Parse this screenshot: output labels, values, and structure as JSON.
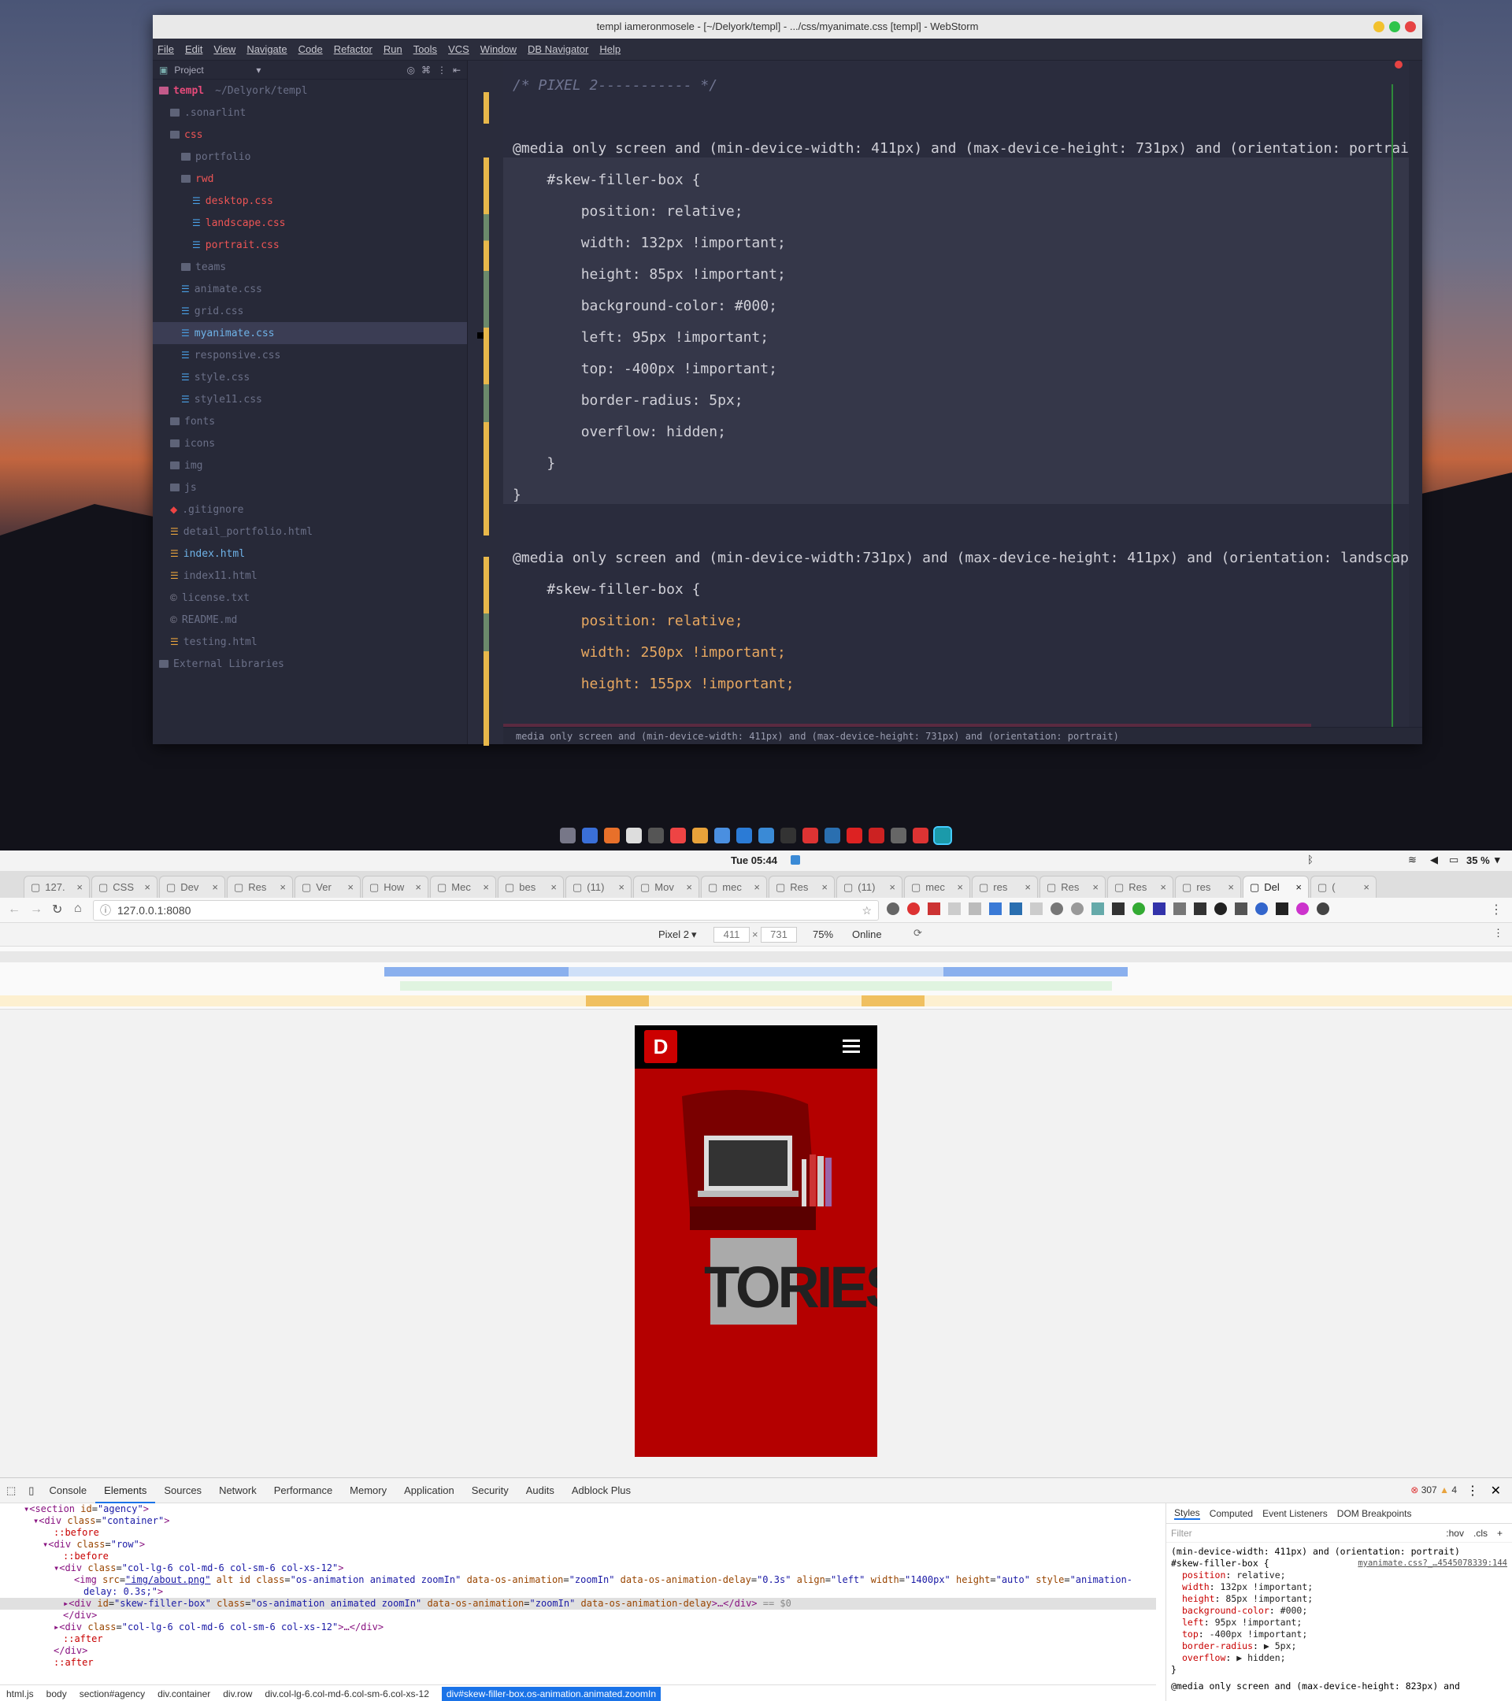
{
  "ide": {
    "title": "templ iameronmosele - [~/Delyork/templ] - .../css/myanimate.css [templ] - WebStorm",
    "menu": [
      "File",
      "Edit",
      "View",
      "Navigate",
      "Code",
      "Refactor",
      "Run",
      "Tools",
      "VCS",
      "Window",
      "DB Navigator",
      "Help"
    ],
    "project_label": "Project",
    "tree": [
      {
        "label": "templ",
        "extra": "~/Delyork/templ",
        "depth": 0,
        "type": "root"
      },
      {
        "label": ".sonarlint",
        "depth": 1,
        "type": "folder",
        "dim": true
      },
      {
        "label": "css",
        "depth": 1,
        "type": "folder",
        "color": "#e55"
      },
      {
        "label": "portfolio",
        "depth": 2,
        "type": "folder",
        "dim": true
      },
      {
        "label": "rwd",
        "depth": 2,
        "type": "folder",
        "color": "#e55"
      },
      {
        "label": "desktop.css",
        "depth": 3,
        "type": "css",
        "color": "#e55"
      },
      {
        "label": "landscape.css",
        "depth": 3,
        "type": "css",
        "color": "#e55"
      },
      {
        "label": "portrait.css",
        "depth": 3,
        "type": "css",
        "color": "#e55"
      },
      {
        "label": "teams",
        "depth": 2,
        "type": "folder",
        "dim": true
      },
      {
        "label": "animate.css",
        "depth": 2,
        "type": "css",
        "dim": true
      },
      {
        "label": "grid.css",
        "depth": 2,
        "type": "css",
        "dim": true
      },
      {
        "label": "myanimate.css",
        "depth": 2,
        "type": "css",
        "color": "#6fb3e8",
        "selected": true
      },
      {
        "label": "responsive.css",
        "depth": 2,
        "type": "css",
        "dim": true
      },
      {
        "label": "style.css",
        "depth": 2,
        "type": "css",
        "dim": true
      },
      {
        "label": "style11.css",
        "depth": 2,
        "type": "css",
        "dim": true
      },
      {
        "label": "fonts",
        "depth": 1,
        "type": "folder",
        "dim": true
      },
      {
        "label": "icons",
        "depth": 1,
        "type": "folder",
        "dim": true
      },
      {
        "label": "img",
        "depth": 1,
        "type": "folder",
        "dim": true
      },
      {
        "label": "js",
        "depth": 1,
        "type": "folder",
        "dim": true
      },
      {
        "label": ".gitignore",
        "depth": 1,
        "type": "git",
        "dim": true
      },
      {
        "label": "detail_portfolio.html",
        "depth": 1,
        "type": "html",
        "dim": true
      },
      {
        "label": "index.html",
        "depth": 1,
        "type": "html",
        "color": "#6fb3e8"
      },
      {
        "label": "index11.html",
        "depth": 1,
        "type": "html",
        "dim": true
      },
      {
        "label": "license.txt",
        "depth": 1,
        "type": "txt",
        "dim": true
      },
      {
        "label": "README.md",
        "depth": 1,
        "type": "txt",
        "dim": true
      },
      {
        "label": "testing.html",
        "depth": 1,
        "type": "html",
        "dim": true
      },
      {
        "label": "External Libraries",
        "depth": 0,
        "type": "lib",
        "dim": true
      }
    ],
    "code": [
      "/* PIXEL 2----------- */",
      "",
      "@media only screen and (min-device-width: 411px) and (max-device-height: 731px) and (orientation: portrait) {",
      "    #skew-filler-box {",
      "        position: relative;",
      "        width: 132px !important;",
      "        height: 85px !important;",
      "        background-color: #000;",
      "        left: 95px !important;",
      "        top: -400px !important;",
      "        border-radius: 5px;",
      "        overflow: hidden;",
      "    }",
      "}",
      "",
      "@media only screen and (min-device-width:731px) and (max-device-height: 411px) and (orientation: landscape) {",
      "    #skew-filler-box {",
      "        position: relative;",
      "        width: 250px !important;",
      "        height: 155px !important;"
    ],
    "breadcrumb": "media only screen and (min-device-width: 411px) and (max-device-height: 731px) and (orientation: portrait)"
  },
  "mac": {
    "clock": "Tue 05:44",
    "battery": "35 %"
  },
  "browser": {
    "tabs": [
      "127.",
      "CSS",
      "Dev",
      "Res",
      "Ver",
      "How",
      "Mec",
      "bes",
      "(11)",
      "Mov",
      "mec",
      "Res",
      "(11)",
      "mec",
      "res",
      "Res",
      "Res",
      "res",
      "Del",
      "("
    ],
    "url": "127.0.0.1:8080",
    "device": "Pixel 2",
    "width": "411",
    "height": "731",
    "zoom": "75%",
    "network": "Online",
    "page_text": "TORIES"
  },
  "devtools": {
    "tabs": [
      "Console",
      "Elements",
      "Sources",
      "Network",
      "Performance",
      "Memory",
      "Application",
      "Security",
      "Audits",
      "Adblock Plus"
    ],
    "errors": "307",
    "warnings": "4",
    "style_tabs": [
      "Styles",
      "Computed",
      "Event Listeners",
      "DOM Breakpoints"
    ],
    "filter_placeholder": "Filter",
    "hov": ":hov",
    "cls": ".cls",
    "media_line": "(min-device-width: 411px) and (orientation: portrait)",
    "selector": "#skew-filler-box {",
    "source": "myanimate.css?_…4545078339:144",
    "props": [
      {
        "n": "position",
        "v": "relative;"
      },
      {
        "n": "width",
        "v": "132px !important;"
      },
      {
        "n": "height",
        "v": "85px !important;"
      },
      {
        "n": "background-color",
        "v": "#000;"
      },
      {
        "n": "left",
        "v": "95px !important;"
      },
      {
        "n": "top",
        "v": "-400px !important;"
      },
      {
        "n": "border-radius",
        "v": "▶ 5px;"
      },
      {
        "n": "overflow",
        "v": "▶ hidden;"
      }
    ],
    "close_brace": "}",
    "media2": "@media only screen and (max-device-height: 823px) and",
    "crumbs": [
      "html.js",
      "body",
      "section#agency",
      "div.container",
      "div.row",
      "div.col-lg-6.col-md-6.col-sm-6.col-xs-12",
      "div#skew-filler-box.os-animation.animated.zoomIn"
    ]
  }
}
